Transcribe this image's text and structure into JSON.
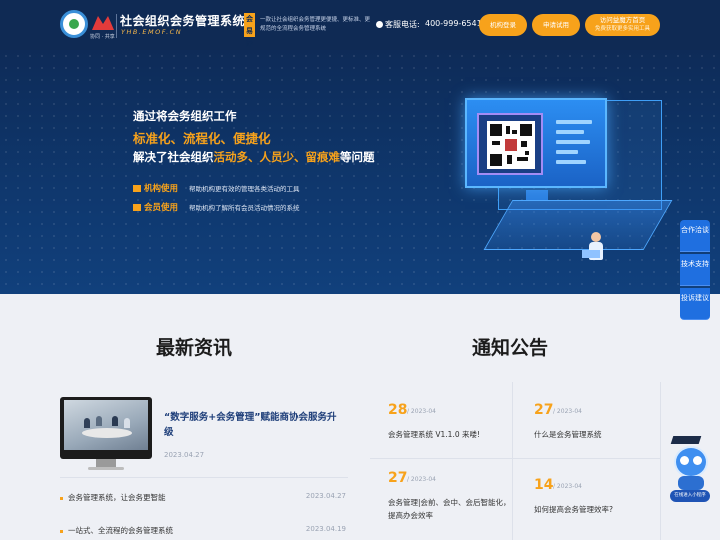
{
  "header": {
    "logo_sub": "协同 · 共享",
    "brand_title": "社会组织会务管理系统",
    "brand_domain": "YHB.EMOF.CN",
    "brand_chip": "会易办",
    "tagline": "一款让社会组织会务管理更便捷、更标准、更规范的全流程会务管理系统",
    "phone_label": "客服电话:",
    "phone_number": "400-999-6541",
    "login_button": "机构登录",
    "trial_button": "申请试用",
    "home_button": "访问益魔方首页",
    "home_button_sub": "免费获取更多实用工具"
  },
  "hero": {
    "line1": "通过将会务组织工作",
    "line2": "标准化、流程化、便捷化",
    "line3_prefix": "解决了社会组织",
    "line3_highlight": "活动多、人员少、留痕难",
    "line3_suffix": "等问题",
    "feature1_title": "机构使用",
    "feature1_desc": "帮助机构更有效的管理各类活动的工具",
    "feature2_title": "会员使用",
    "feature2_desc": "帮助机构了解所有会员活动情况的系统"
  },
  "side_tools": {
    "coop": "合作洽谈",
    "support": "技术支持",
    "complaint": "投诉建议"
  },
  "news": {
    "title": "最新资讯",
    "headline": "“数字服务+会务管理”赋能商协会服务升级",
    "headline_date": "2023.04.27",
    "items": [
      {
        "text": "会务管理系统，让会务更智能",
        "date": "2023.04.27"
      },
      {
        "text": "一站式、全流程的会务管理系统",
        "date": "2023.04.19"
      }
    ]
  },
  "notice": {
    "title": "通知公告",
    "items": [
      {
        "day": "28",
        "ym": "/ 2023-04",
        "title": "会务管理系统 V1.1.0 来喽!"
      },
      {
        "day": "27",
        "ym": "/ 2023-04",
        "title": "什么是会务管理系统"
      },
      {
        "day": "27",
        "ym": "/ 2023-04",
        "title": "会务管理|会前、会中、会后智能化，提高办会效率"
      },
      {
        "day": "14",
        "ym": "/ 2023-04",
        "title": "如何提高会务管理效率?"
      }
    ]
  },
  "mascot": {
    "label": "在线进入小程序"
  },
  "colors": {
    "accent": "#f7a21b",
    "header_bg": "#0f2a54",
    "side_tool_bg": "#1f6fe0",
    "headline_text": "#1f3f7a"
  },
  "icons": {
    "phone": "phone-icon",
    "feature1": "institution-icon",
    "feature2": "crown-icon"
  }
}
